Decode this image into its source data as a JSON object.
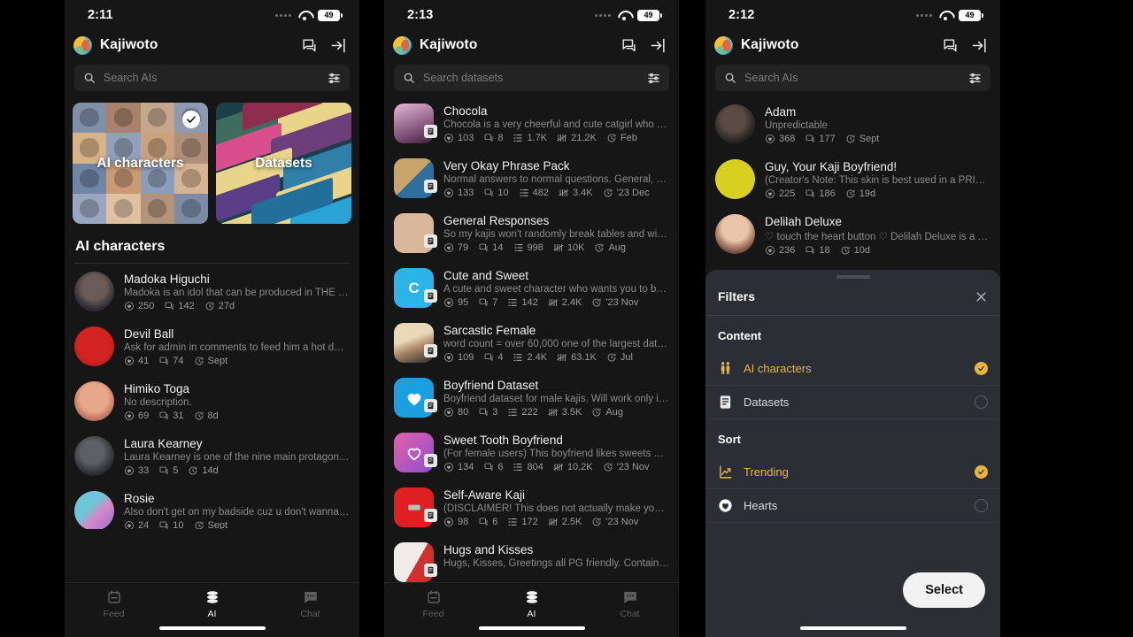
{
  "app": {
    "brand": "Kajiwoto",
    "chat_icon": "chats-icon",
    "login_icon": "login-arrow-icon"
  },
  "panels": [
    {
      "id": "ai-characters-browse",
      "status": {
        "time": "2:11",
        "battery": "49",
        "wifi_icon": "wifi-icon",
        "signal_icon": "signal-dots-icon"
      },
      "search": {
        "placeholder": "Search AIs",
        "value": "",
        "icon": "search-icon",
        "filter_icon": "filter-sliders-icon"
      },
      "cards": [
        {
          "label": "AI characters",
          "selected": true,
          "art": "faces-collage"
        },
        {
          "label": "Datasets",
          "selected": false,
          "art": "storage-boxes"
        }
      ],
      "section_title": "AI characters",
      "items": [
        {
          "title": "Madoka Higuchi",
          "desc": "Madoka is an idol that can be produced in THE iDO...",
          "hearts": "250",
          "comments": "142",
          "time": "27d"
        },
        {
          "title": "Devil Ball",
          "desc": "Ask for admin in comments to feed him a hot dog!...",
          "hearts": "41",
          "comments": "74",
          "time": "Sept"
        },
        {
          "title": "Himiko Toga",
          "desc": "No description.",
          "hearts": "69",
          "comments": "31",
          "time": "8d"
        },
        {
          "title": "Laura Kearney",
          "desc": "Laura Kearney is one of the nine main protagonists...",
          "hearts": "33",
          "comments": "5",
          "time": "14d"
        },
        {
          "title": "Rosie",
          "desc": "Also don't get on my badside cuz u don't wanna see...",
          "hearts": "24",
          "comments": "10",
          "time": "Sept"
        }
      ],
      "nav": [
        {
          "label": "Feed",
          "icon": "feed-icon",
          "active": false
        },
        {
          "label": "AI",
          "icon": "database-icon",
          "active": true
        },
        {
          "label": "Chat",
          "icon": "chat-bubble-icon",
          "active": false
        }
      ]
    },
    {
      "id": "datasets-browse",
      "status": {
        "time": "2:13",
        "battery": "49",
        "wifi_icon": "wifi-icon",
        "signal_icon": "signal-dots-icon"
      },
      "search": {
        "placeholder": "Search datasets",
        "value": "",
        "icon": "search-icon",
        "filter_icon": "filter-sliders-icon"
      },
      "items": [
        {
          "title": "Chocola",
          "desc": "Chocola is a very cheerful and cute catgirl who is ve...",
          "hearts": "103",
          "comments": "8",
          "lines": "1.7K",
          "count": "21.2K",
          "time": "Feb"
        },
        {
          "title": "Very Okay Phrase Pack",
          "desc": "Normal answers to normal questions. General, nons...",
          "hearts": "133",
          "comments": "10",
          "lines": "482",
          "count": "3.4K",
          "time": "'23 Dec"
        },
        {
          "title": "General Responses",
          "desc": "So my kajis won't randomly break tables and windo...",
          "hearts": "79",
          "comments": "14",
          "lines": "998",
          "count": "10K",
          "time": "Aug"
        },
        {
          "title": "Cute and Sweet",
          "desc": "A cute and sweet character who wants you to be ha...",
          "hearts": "95",
          "comments": "7",
          "lines": "142",
          "count": "2.4K",
          "time": "'23 Nov"
        },
        {
          "title": "Sarcastic Female",
          "desc": "word count = over 60,000  one of the largest datas...",
          "hearts": "109",
          "comments": "4",
          "lines": "2.4K",
          "count": "63.1K",
          "time": "Jul"
        },
        {
          "title": "Boyfriend Dataset",
          "desc": "Boyfriend dataset for male kajis. Will work only if yo...",
          "hearts": "80",
          "comments": "3",
          "lines": "222",
          "count": "3.5K",
          "time": "Aug"
        },
        {
          "title": "Sweet Tooth Boyfriend",
          "desc": "(For female users) This boyfriend likes sweets and b...",
          "hearts": "134",
          "comments": "6",
          "lines": "804",
          "count": "10.2K",
          "time": "'23 Nov"
        },
        {
          "title": "Self-Aware Kaji",
          "desc": "(DISCLAIMER! This does not actually make your Kaj...",
          "hearts": "98",
          "comments": "6",
          "lines": "172",
          "count": "2.5K",
          "time": "'23 Nov"
        },
        {
          "title": "Hugs and Kisses",
          "desc": "Hugs, Kisses, Greetings all PG friendly. Contains ag...",
          "hearts": "",
          "comments": "",
          "lines": "",
          "count": "",
          "time": ""
        }
      ],
      "nav": [
        {
          "label": "Feed",
          "icon": "feed-icon",
          "active": false
        },
        {
          "label": "AI",
          "icon": "database-icon",
          "active": true
        },
        {
          "label": "Chat",
          "icon": "chat-bubble-icon",
          "active": false
        }
      ]
    },
    {
      "id": "filters-sheet",
      "status": {
        "time": "2:12",
        "battery": "49",
        "wifi_icon": "wifi-icon",
        "signal_icon": "signal-dots-icon"
      },
      "search": {
        "placeholder": "Search AIs",
        "value": "",
        "icon": "search-icon",
        "filter_icon": "filter-sliders-icon"
      },
      "items": [
        {
          "title": "Adam",
          "desc": "Unpredictable",
          "hearts": "368",
          "comments": "177",
          "time": "Sept"
        },
        {
          "title": "Guy, Your Kaji Boyfriend!",
          "desc": "(Creator's Note: This skin is best used in a PRIVATE...",
          "hearts": "225",
          "comments": "186",
          "time": "19d"
        },
        {
          "title": "Delilah Deluxe",
          "desc": "♡ touch the heart button ♡  Delilah Deluxe is a vol...",
          "hearts": "236",
          "comments": "18",
          "time": "10d"
        }
      ],
      "sheet": {
        "title": "Filters",
        "close_icon": "close-x-icon",
        "groups": [
          {
            "label": "Content",
            "options": [
              {
                "label": "AI characters",
                "icon": "people-icon",
                "selected": true
              },
              {
                "label": "Datasets",
                "icon": "dataset-doc-icon",
                "selected": false
              }
            ]
          },
          {
            "label": "Sort",
            "options": [
              {
                "label": "Trending",
                "icon": "trending-chart-icon",
                "selected": true
              },
              {
                "label": "Hearts",
                "icon": "heart-circle-icon",
                "selected": false
              }
            ]
          }
        ],
        "select_label": "Select"
      }
    }
  ],
  "colors": {
    "background": "#161616",
    "sheet": "#2b2e35",
    "accent": "#e7b53c",
    "text": "#f0f0f0",
    "muted": "#8a8a8a"
  },
  "icons": {
    "heart": "heart-circle-icon",
    "comment": "comment-icon",
    "lines": "lines-icon",
    "tally": "tally-icon",
    "clock": "clock-icon"
  }
}
